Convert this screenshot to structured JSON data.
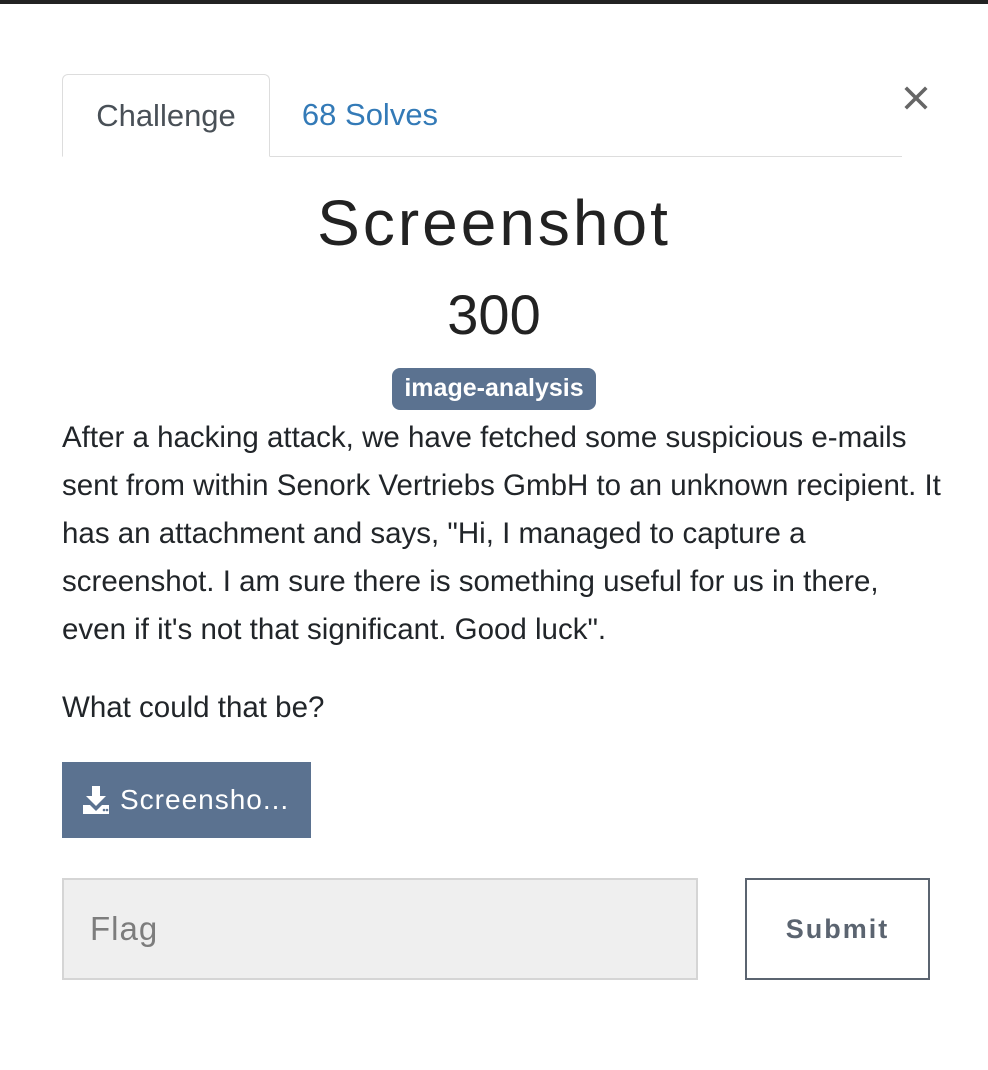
{
  "modal": {
    "close_label": "×"
  },
  "tabs": [
    {
      "label": "Challenge",
      "active": true
    },
    {
      "label": "68 Solves",
      "active": false
    }
  ],
  "challenge": {
    "name": "Screenshot",
    "points": "300",
    "tag": "image-analysis",
    "description": "After a hacking attack, we have fetched some suspicious e-mails sent from within Senork Vertriebs GmbH to an unknown recipient. It has an attachment and says, \"Hi, I managed to capture a screenshot. I am sure there is something useful for us in there, even if it's not that significant. Good luck\".",
    "question": "What could that be?",
    "file_label": "Screensho...",
    "file_icon": "download-icon"
  },
  "form": {
    "flag_placeholder": "Flag",
    "submit_label": "Submit"
  },
  "colors": {
    "accent": "#5b7290",
    "link": "#337ab7"
  }
}
